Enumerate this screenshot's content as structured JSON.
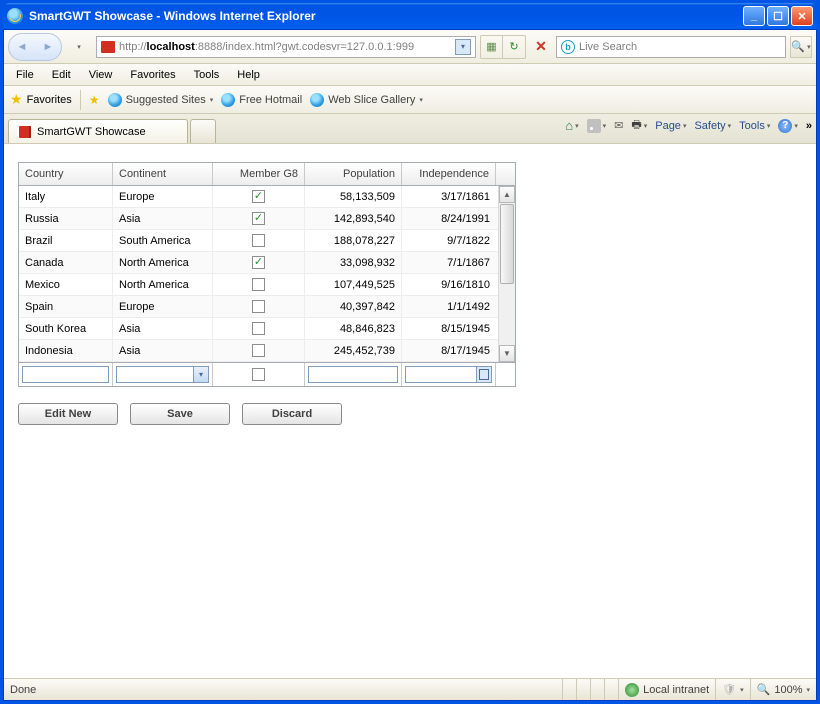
{
  "window": {
    "title": "SmartGWT Showcase - Windows Internet Explorer"
  },
  "nav": {
    "url_prefix": "http://",
    "url_host": "localhost",
    "url_rest": ":8888/index.html?gwt.codesvr=127.0.0.1:999",
    "search_placeholder": "Live Search"
  },
  "menu": [
    "File",
    "Edit",
    "View",
    "Favorites",
    "Tools",
    "Help"
  ],
  "favbar": {
    "label": "Favorites",
    "suggested": "Suggested Sites",
    "hotmail": "Free Hotmail",
    "webslice": "Web Slice Gallery"
  },
  "tab": {
    "title": "SmartGWT Showcase"
  },
  "tabtools": {
    "page": "Page",
    "safety": "Safety",
    "tools": "Tools"
  },
  "grid": {
    "headers": {
      "country": "Country",
      "continent": "Continent",
      "g8": "Member G8",
      "population": "Population",
      "independence": "Independence"
    },
    "rows": [
      {
        "country": "Italy",
        "continent": "Europe",
        "g8": true,
        "population": "58,133,509",
        "independence": "3/17/1861"
      },
      {
        "country": "Russia",
        "continent": "Asia",
        "g8": true,
        "population": "142,893,540",
        "independence": "8/24/1991"
      },
      {
        "country": "Brazil",
        "continent": "South America",
        "g8": false,
        "population": "188,078,227",
        "independence": "9/7/1822"
      },
      {
        "country": "Canada",
        "continent": "North America",
        "g8": true,
        "population": "33,098,932",
        "independence": "7/1/1867"
      },
      {
        "country": "Mexico",
        "continent": "North America",
        "g8": false,
        "population": "107,449,525",
        "independence": "9/16/1810"
      },
      {
        "country": "Spain",
        "continent": "Europe",
        "g8": false,
        "population": "40,397,842",
        "independence": "1/1/1492"
      },
      {
        "country": "South Korea",
        "continent": "Asia",
        "g8": false,
        "population": "48,846,823",
        "independence": "8/15/1945"
      },
      {
        "country": "Indonesia",
        "continent": "Asia",
        "g8": false,
        "population": "245,452,739",
        "independence": "8/17/1945"
      }
    ]
  },
  "buttons": {
    "editnew": "Edit New",
    "save": "Save",
    "discard": "Discard"
  },
  "status": {
    "done": "Done",
    "zone": "Local intranet",
    "zoom": "100%"
  }
}
